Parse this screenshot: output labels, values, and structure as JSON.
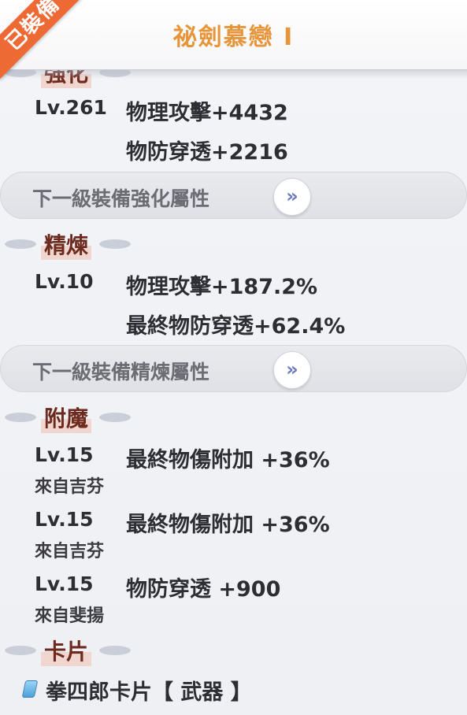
{
  "header": {
    "title": "祕劍慕戀 I",
    "equipped_badge": "已裝備"
  },
  "enhance": {
    "section_title": "強化",
    "level": "Lv.261",
    "stats": [
      "物理攻擊+4432",
      "物防穿透+2216"
    ],
    "next_label": "下一級裝備強化屬性"
  },
  "refine": {
    "section_title": "精煉",
    "level": "Lv.10",
    "stats": [
      "物理攻擊+187.2%",
      "最終物防穿透+62.4%"
    ],
    "next_label": "下一級裝備精煉屬性"
  },
  "enchant": {
    "section_title": "附魔",
    "entries": [
      {
        "level": "Lv.15",
        "stat": "最終物傷附加 +36%",
        "source": "來自吉芬"
      },
      {
        "level": "Lv.15",
        "stat": "最終物傷附加 +36%",
        "source": "來自吉芬"
      },
      {
        "level": "Lv.15",
        "stat": "物防穿透 +900",
        "source": "來自斐揚"
      }
    ]
  },
  "cards": {
    "section_title": "卡片",
    "items": [
      {
        "name": "拳四郎卡片【 武器 】",
        "icon": "card-gem-icon",
        "icon_color": "#4b9fd8"
      }
    ]
  },
  "colors": {
    "title": "#e7953a",
    "badge": "#ee6a35",
    "section_title": "#6d2b1f"
  }
}
